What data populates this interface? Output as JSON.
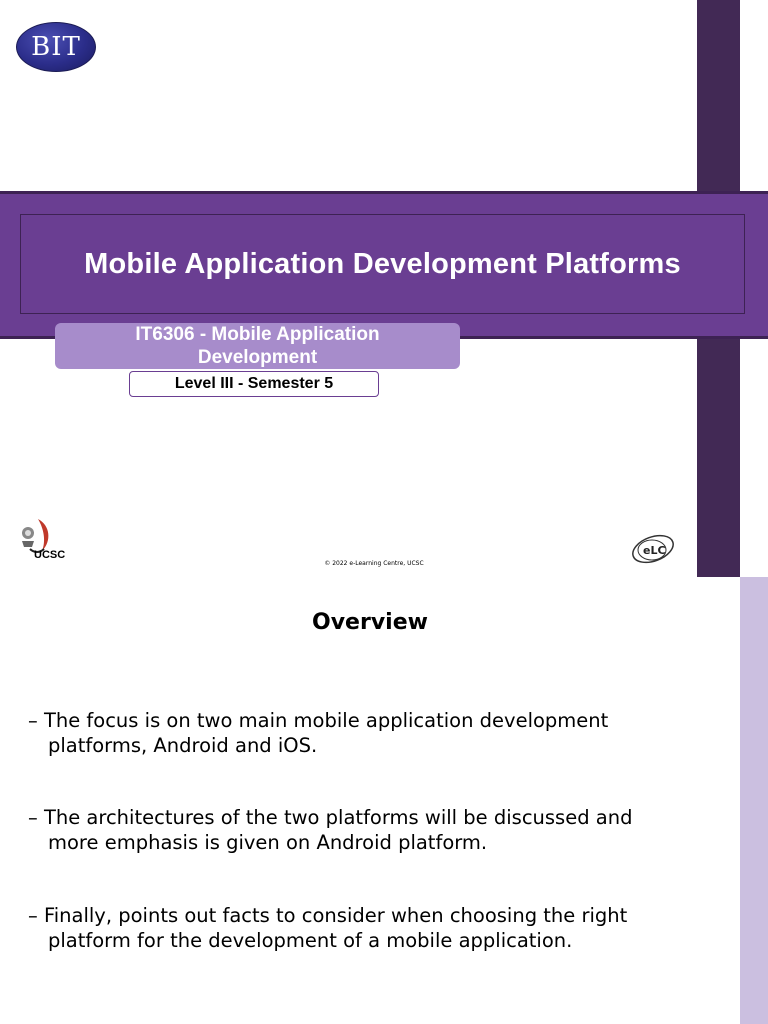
{
  "slide1": {
    "logo_text": "BIT",
    "title": "Mobile Application Development Platforms",
    "course": "IT6306 - Mobile Application Development",
    "level": "Level III - Semester 5",
    "ucsc_logo_text": "UCSC",
    "copyright": "© 2022 e-Learning Centre, UCSC",
    "elc_logo_text": "eLC"
  },
  "slide2": {
    "heading": "Overview",
    "bullets": [
      "– The focus is on two main mobile application development platforms, Android and iOS.",
      "– The architectures of the two platforms will be discussed and more emphasis is given on Android platform.",
      "– Finally, points out facts to consider when choosing the right platform for the development of a mobile application."
    ]
  },
  "colors": {
    "accent_purple": "#6a3e92",
    "dark_purple": "#422955",
    "light_purple": "#a78ccb",
    "strip_lilac": "#cbbfe0"
  }
}
